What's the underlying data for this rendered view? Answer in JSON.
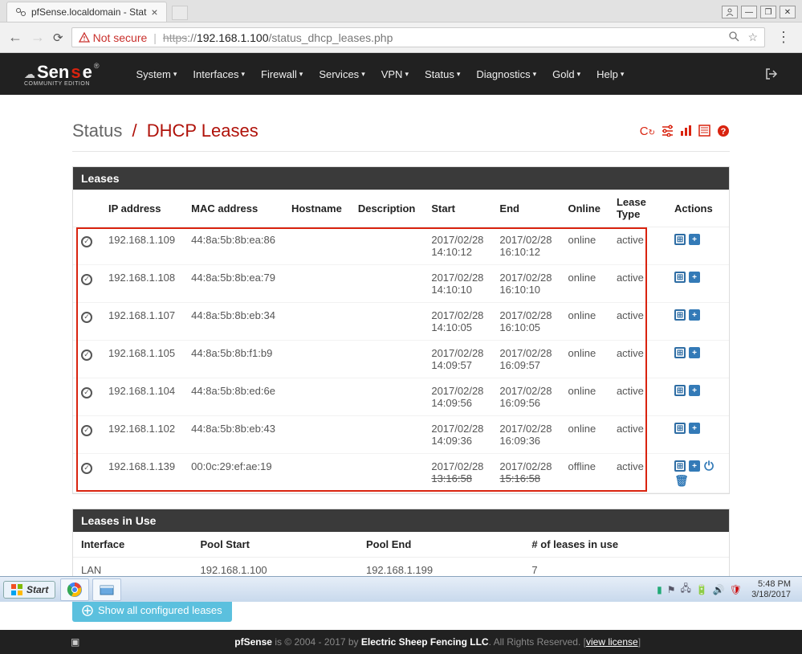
{
  "browser": {
    "tab_title": "pfSense.localdomain - Stat",
    "not_secure": "Not secure",
    "url_scheme": "https",
    "url_sep": "://",
    "url_host": "192.168.1.100",
    "url_path": "/status_dhcp_leases.php"
  },
  "nav": {
    "items": [
      "System",
      "Interfaces",
      "Firewall",
      "Services",
      "VPN",
      "Status",
      "Diagnostics",
      "Gold",
      "Help"
    ]
  },
  "breadcrumb": {
    "root": "Status",
    "page": "DHCP Leases"
  },
  "panel1_title": "Leases",
  "columns": [
    "IP address",
    "MAC address",
    "Hostname",
    "Description",
    "Start",
    "End",
    "Online",
    "Lease Type",
    "Actions"
  ],
  "leases": [
    {
      "ip": "192.168.1.109",
      "mac": "44:8a:5b:8b:ea:86",
      "host": "",
      "desc": "",
      "start": "2017/02/28 14:10:12",
      "end": "2017/02/28 16:10:12",
      "online": "online",
      "type": "active"
    },
    {
      "ip": "192.168.1.108",
      "mac": "44:8a:5b:8b:ea:79",
      "host": "",
      "desc": "",
      "start": "2017/02/28 14:10:10",
      "end": "2017/02/28 16:10:10",
      "online": "online",
      "type": "active"
    },
    {
      "ip": "192.168.1.107",
      "mac": "44:8a:5b:8b:eb:34",
      "host": "",
      "desc": "",
      "start": "2017/02/28 14:10:05",
      "end": "2017/02/28 16:10:05",
      "online": "online",
      "type": "active"
    },
    {
      "ip": "192.168.1.105",
      "mac": "44:8a:5b:8b:f1:b9",
      "host": "",
      "desc": "",
      "start": "2017/02/28 14:09:57",
      "end": "2017/02/28 16:09:57",
      "online": "online",
      "type": "active"
    },
    {
      "ip": "192.168.1.104",
      "mac": "44:8a:5b:8b:ed:6e",
      "host": "",
      "desc": "",
      "start": "2017/02/28 14:09:56",
      "end": "2017/02/28 16:09:56",
      "online": "online",
      "type": "active"
    },
    {
      "ip": "192.168.1.102",
      "mac": "44:8a:5b:8b:eb:43",
      "host": "",
      "desc": "",
      "start": "2017/02/28 14:09:36",
      "end": "2017/02/28 16:09:36",
      "online": "online",
      "type": "active"
    },
    {
      "ip": "192.168.1.139",
      "mac": "00:0c:29:ef:ae:19",
      "host": "",
      "desc": "",
      "start": "2017/02/28 13:16:58",
      "end": "2017/02/28 15:16:58",
      "online": "offline",
      "type": "active"
    }
  ],
  "panel2_title": "Leases in Use",
  "inuse_columns": [
    "Interface",
    "Pool Start",
    "Pool End",
    "# of leases in use"
  ],
  "inuse": [
    {
      "iface": "LAN",
      "start": "192.168.1.100",
      "end": "192.168.1.199",
      "count": "7"
    }
  ],
  "show_all_btn": "Show all configured leases",
  "footer": {
    "brand": "pfSense",
    "mid": " is © 2004 - 2017 by ",
    "co": "Electric Sheep Fencing LLC",
    "tail": ". All Rights Reserved. [",
    "link": "view license",
    "tail2": "]"
  },
  "taskbar": {
    "start": "Start",
    "time": "5:48 PM",
    "date": "3/18/2017"
  }
}
